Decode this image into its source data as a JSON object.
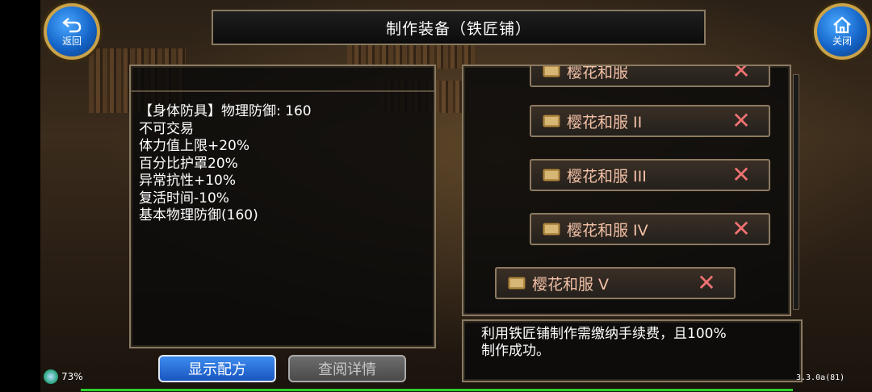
{
  "header": {
    "title": "制作装备（铁匠铺）",
    "back_label": "返回",
    "close_label": "关闭"
  },
  "item_info": {
    "lines": [
      "【身体防具】物理防御: 160",
      "不可交易",
      "体力值上限+20%",
      "百分比护罩20%",
      "异常抗性+10%",
      "复活时间-10%",
      "基本物理防御(160)"
    ]
  },
  "recipe_list": {
    "items": [
      {
        "name": "樱花和服",
        "remove": "✕"
      },
      {
        "name": "樱花和服 II",
        "remove": "✕"
      },
      {
        "name": "樱花和服 III",
        "remove": "✕"
      },
      {
        "name": "樱花和服  IV",
        "remove": "✕"
      },
      {
        "name": "樱花和服  V",
        "remove": "✕"
      }
    ]
  },
  "description": {
    "lines": [
      "利用铁匠铺制作需缴纳手续费，且100%",
      "制作成功。"
    ]
  },
  "buttons": {
    "show_recipe": "显示配方",
    "view_details": "查阅详情"
  },
  "status": {
    "battery": "73%",
    "version": "3.3.0a(81)"
  },
  "colors": {
    "accent_blue": "#1a56c0",
    "item_text": "#f2c0a6",
    "remove_x": "#f07272",
    "frame": "#8a7a62"
  }
}
